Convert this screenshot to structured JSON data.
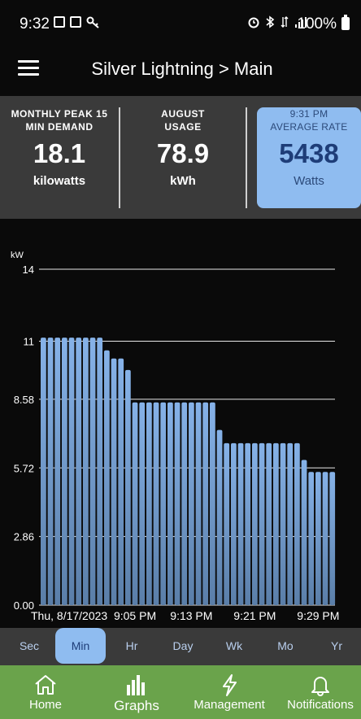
{
  "status_bar": {
    "time": "9:32",
    "battery": "100%",
    "icons_left": [
      "image-icon",
      "cast-icon",
      "key-icon"
    ],
    "icons_right": [
      "alarm-icon",
      "bluetooth-icon",
      "data-icon",
      "signal-icon",
      "battery-icon"
    ]
  },
  "app_bar": {
    "title": "Silver Lightning > Main"
  },
  "summary": {
    "peak": {
      "label_line1": "MONTHLY PEAK 15",
      "label_line2": "MIN DEMAND",
      "value": "18.1",
      "unit": "kilowatts"
    },
    "usage": {
      "label_line1": "AUGUST",
      "label_line2": "USAGE",
      "value": "78.9",
      "unit": "kWh"
    },
    "rate": {
      "label_line1": "9:31 PM",
      "label_line2": "AVERAGE RATE",
      "value": "5438",
      "unit": "Watts"
    }
  },
  "colors": {
    "accent": "#8fbcf0",
    "nav_bg": "#6aa34b",
    "panel_bg": "#3a3a3a",
    "bar": "#7fa8dc"
  },
  "chart_data": {
    "type": "bar",
    "ylabel": "kW",
    "ylim": [
      0,
      14
    ],
    "yticks": [
      "0.00",
      "2.86",
      "5.72",
      "8.58",
      "11",
      "14"
    ],
    "ytick_values": [
      0,
      2.86,
      5.72,
      8.58,
      11,
      14
    ],
    "xtick_labels": [
      "Thu, 8/17/2023",
      "9:05 PM",
      "9:13 PM",
      "9:21 PM",
      "9:29 PM"
    ],
    "xtick_index": [
      0,
      13,
      21,
      30,
      39
    ],
    "values": [
      11.15,
      11.15,
      11.15,
      11.15,
      11.15,
      11.15,
      11.15,
      11.15,
      11.15,
      10.62,
      10.28,
      10.28,
      9.8,
      8.45,
      8.45,
      8.45,
      8.45,
      8.45,
      8.45,
      8.45,
      8.45,
      8.45,
      8.45,
      8.45,
      8.45,
      7.3,
      6.75,
      6.75,
      6.75,
      6.75,
      6.75,
      6.75,
      6.75,
      6.75,
      6.75,
      6.75,
      6.75,
      6.05,
      5.55,
      5.55,
      5.55,
      5.55
    ],
    "grid": true
  },
  "tabs": [
    "Sec",
    "Min",
    "Hr",
    "Day",
    "Wk",
    "Mo",
    "Yr"
  ],
  "active_tab": "Min",
  "nav": [
    {
      "label": "Home",
      "icon": "home-icon"
    },
    {
      "label": "Graphs",
      "icon": "bar-chart-icon"
    },
    {
      "label": "Management",
      "icon": "lightning-icon"
    },
    {
      "label": "Notifications",
      "icon": "bell-icon"
    }
  ]
}
